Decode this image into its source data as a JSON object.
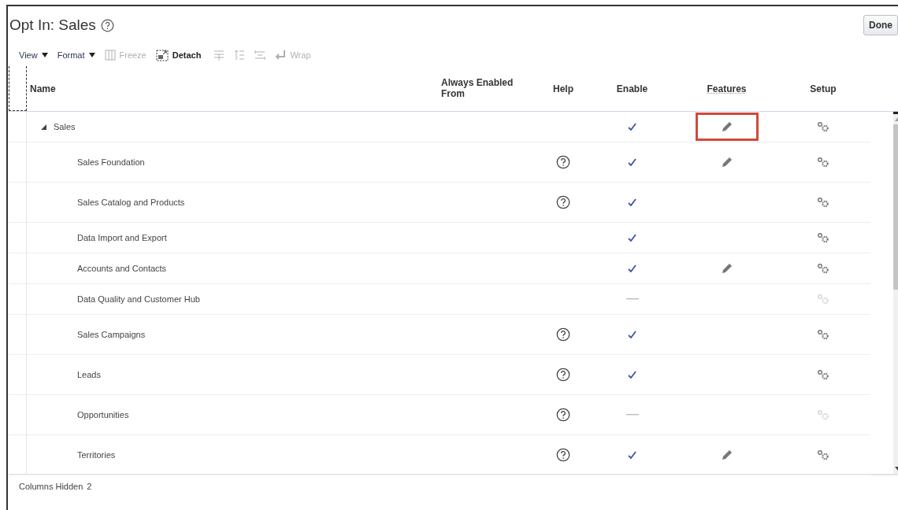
{
  "title": "Opt In: Sales",
  "done_button": "Done",
  "toolbar": [
    {
      "label": "View",
      "kind": "menu",
      "disabled": false
    },
    {
      "label": "Format",
      "kind": "menu",
      "disabled": false
    },
    {
      "label": "Freeze",
      "kind": "freeze",
      "disabled": true
    },
    {
      "label": "Detach",
      "kind": "detach",
      "disabled": false
    },
    {
      "kind": "wrap-lines",
      "disabled": true
    },
    {
      "kind": "wrap-up",
      "disabled": true
    },
    {
      "kind": "wrap-swap",
      "disabled": true
    },
    {
      "label": "Wrap",
      "kind": "wrap",
      "disabled": true
    }
  ],
  "table": {
    "columns": [
      "Name",
      "Always Enabled From",
      "Help",
      "Enable",
      "Features",
      "Setup"
    ],
    "rows": [
      {
        "name": "Sales",
        "expanded": true,
        "help": false,
        "enabled": true,
        "features": true,
        "highlighted": true,
        "setup_enabled": true,
        "children": [
          {
            "name": "Sales Foundation",
            "help": true,
            "enabled": true,
            "features": true,
            "highlighted": false,
            "setup_enabled": true
          },
          {
            "name": "Sales Catalog and Products",
            "help": true,
            "enabled": true,
            "features": false,
            "highlighted": false,
            "setup_enabled": true
          },
          {
            "name": "Data Import and Export",
            "help": false,
            "enabled": true,
            "features": false,
            "highlighted": false,
            "setup_enabled": true
          },
          {
            "name": "Accounts and Contacts",
            "help": false,
            "enabled": true,
            "features": true,
            "highlighted": false,
            "setup_enabled": true
          },
          {
            "name": "Data Quality and Customer Hub",
            "help": false,
            "enabled": false,
            "features": false,
            "highlighted": false,
            "setup_enabled": false
          },
          {
            "name": "Sales Campaigns",
            "help": true,
            "enabled": true,
            "features": false,
            "highlighted": false,
            "setup_enabled": true
          },
          {
            "name": "Leads",
            "help": true,
            "enabled": true,
            "features": false,
            "highlighted": false,
            "setup_enabled": true
          },
          {
            "name": "Opportunities",
            "help": true,
            "enabled": false,
            "features": false,
            "highlighted": false,
            "setup_enabled": false
          },
          {
            "name": "Territories",
            "help": true,
            "enabled": true,
            "features": true,
            "highlighted": false,
            "setup_enabled": true
          }
        ]
      }
    ]
  },
  "status": {
    "label": "Columns Hidden",
    "value": "2"
  }
}
